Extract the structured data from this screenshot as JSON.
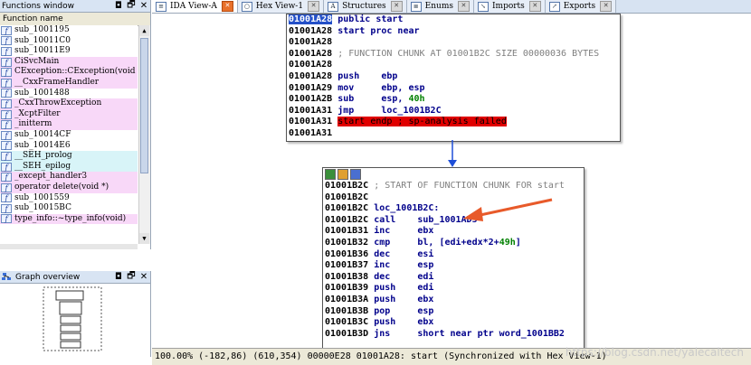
{
  "functions_window": {
    "title": "Functions window",
    "column_header": "Function name",
    "icon": "f",
    "items": [
      {
        "name": "sub_1001195",
        "bg": "#ffffff"
      },
      {
        "name": "sub_10011C0",
        "bg": "#ffffff"
      },
      {
        "name": "sub_10011E9",
        "bg": "#ffffff"
      },
      {
        "name": "CiSvcMain",
        "bg": "#f8d8f8"
      },
      {
        "name": "CException::CException(void",
        "bg": "#f8d8f8"
      },
      {
        "name": "__CxxFrameHandler",
        "bg": "#f8d8f8"
      },
      {
        "name": "sub_1001488",
        "bg": "#ffffff"
      },
      {
        "name": "_CxxThrowException",
        "bg": "#f8d8f8"
      },
      {
        "name": "_XcptFilter",
        "bg": "#f8d8f8"
      },
      {
        "name": "_initterm",
        "bg": "#f8d8f8"
      },
      {
        "name": "sub_10014CF",
        "bg": "#ffffff"
      },
      {
        "name": "sub_10014E6",
        "bg": "#ffffff"
      },
      {
        "name": "__SEH_prolog",
        "bg": "#d8f4f8"
      },
      {
        "name": "__SEH_epilog",
        "bg": "#d8f4f8"
      },
      {
        "name": "_except_handler3",
        "bg": "#f8d8f8"
      },
      {
        "name": "operator delete(void *)",
        "bg": "#f8d8f8"
      },
      {
        "name": "sub_1001559",
        "bg": "#ffffff"
      },
      {
        "name": "sub_10015BC",
        "bg": "#ffffff"
      },
      {
        "name": "type_info::~type_info(void)",
        "bg": "#f8d8f8"
      }
    ]
  },
  "graph_overview": {
    "title": "Graph overview"
  },
  "window_buttons": {
    "pin": "◘",
    "restore": "🗗",
    "close": "✕"
  },
  "tabs": [
    {
      "label": "IDA View-A",
      "icon": "ida-view-icon",
      "active": true
    },
    {
      "label": "Hex View-1",
      "icon": "hex-view-icon",
      "active": false
    },
    {
      "label": "Structures",
      "icon": "structures-icon",
      "active": false
    },
    {
      "label": "Enums",
      "icon": "enums-icon",
      "active": false
    },
    {
      "label": "Imports",
      "icon": "imports-icon",
      "active": false
    },
    {
      "label": "Exports",
      "icon": "exports-icon",
      "active": false
    }
  ],
  "node1": {
    "lines": [
      {
        "addr": "01001A28",
        "text": "public start",
        "kind": "sel"
      },
      {
        "addr": "01001A28",
        "text": "start proc near",
        "kind": "label"
      },
      {
        "addr": "01001A28",
        "text": "",
        "kind": "plain"
      },
      {
        "addr": "01001A28",
        "text": "; FUNCTION CHUNK AT 01001B2C SIZE 00000036 BYTES",
        "kind": "cmt"
      },
      {
        "addr": "01001A28",
        "text": "",
        "kind": "plain"
      },
      {
        "addr": "01001A28",
        "mn": "push",
        "op": "ebp",
        "kind": "ins"
      },
      {
        "addr": "01001A29",
        "mn": "mov",
        "op": "ebp, esp",
        "kind": "ins"
      },
      {
        "addr": "01001A2B",
        "mn": "sub",
        "op": "esp, ",
        "num": "40h",
        "kind": "ins"
      },
      {
        "addr": "01001A31",
        "mn": "jmp",
        "op": "loc_1001B2C",
        "kind": "ins"
      },
      {
        "addr": "01001A31",
        "text": "start endp ; sp-analysis failed",
        "kind": "red"
      },
      {
        "addr": "01001A31",
        "text": "",
        "kind": "plain"
      }
    ]
  },
  "node2": {
    "lines": [
      {
        "addr": "01001B2C",
        "text": "; START OF FUNCTION CHUNK FOR start",
        "kind": "cmt"
      },
      {
        "addr": "01001B2C",
        "text": "",
        "kind": "plain"
      },
      {
        "addr": "01001B2C",
        "text": "loc_1001B2C:",
        "kind": "label"
      },
      {
        "addr": "01001B2C",
        "mn": "call",
        "op": "sub_1001AD5",
        "kind": "ins"
      },
      {
        "addr": "01001B31",
        "mn": "inc",
        "op": "ebx",
        "kind": "ins"
      },
      {
        "addr": "01001B32",
        "mn": "cmp",
        "op": "bl, [edi+edx*2+",
        "num": "49h",
        "tail": "]",
        "kind": "ins"
      },
      {
        "addr": "01001B36",
        "mn": "dec",
        "op": "esi",
        "kind": "ins"
      },
      {
        "addr": "01001B37",
        "mn": "inc",
        "op": "esp",
        "kind": "ins"
      },
      {
        "addr": "01001B38",
        "mn": "dec",
        "op": "edi",
        "kind": "ins"
      },
      {
        "addr": "01001B39",
        "mn": "push",
        "op": "edi",
        "kind": "ins"
      },
      {
        "addr": "01001B3A",
        "mn": "push",
        "op": "ebx",
        "kind": "ins"
      },
      {
        "addr": "01001B3B",
        "mn": "pop",
        "op": "esp",
        "kind": "ins"
      },
      {
        "addr": "01001B3C",
        "mn": "push",
        "op": "ebx",
        "kind": "ins"
      },
      {
        "addr": "01001B3D",
        "mn": "jns",
        "op": "short near ptr word_1001BB2",
        "kind": "ins"
      }
    ]
  },
  "status_bar": {
    "text": "100.00% (-182,86) (610,354) 00000E28 01001A28: start (Synchronized with Hex View-1)"
  },
  "watermark": "https://blog.csdn.net/yalecaltech",
  "colors": {
    "accent": "#e8702a",
    "error_line": "#e00000",
    "arrow": "#e85a2a",
    "edge": "#1f4fd8"
  }
}
